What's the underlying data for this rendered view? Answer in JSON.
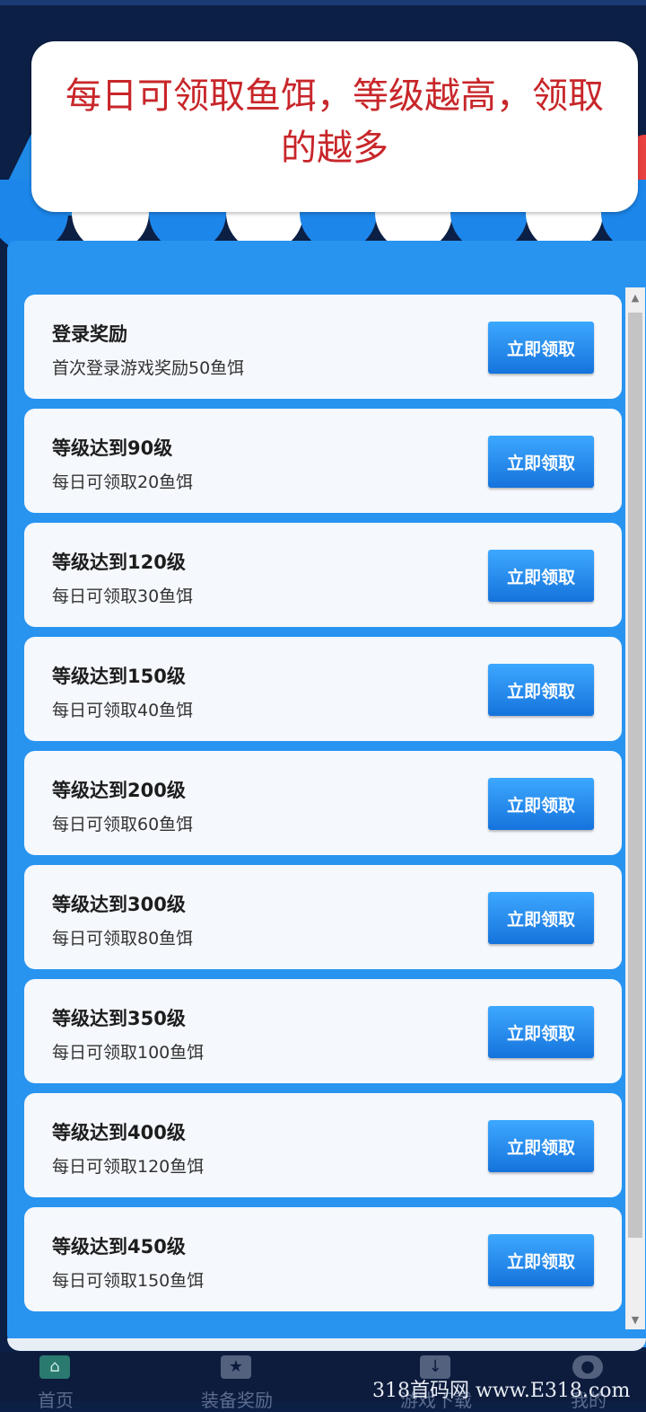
{
  "banner": {
    "text": "每日可领取鱼饵，等级越高，领取的越多"
  },
  "rewards": [
    {
      "title": "登录奖励",
      "desc": "首次登录游戏奖励50鱼饵",
      "button": "立即领取"
    },
    {
      "title": "等级达到90级",
      "desc": "每日可领取20鱼饵",
      "button": "立即领取"
    },
    {
      "title": "等级达到120级",
      "desc": "每日可领取30鱼饵",
      "button": "立即领取"
    },
    {
      "title": "等级达到150级",
      "desc": "每日可领取40鱼饵",
      "button": "立即领取"
    },
    {
      "title": "等级达到200级",
      "desc": "每日可领取60鱼饵",
      "button": "立即领取"
    },
    {
      "title": "等级达到300级",
      "desc": "每日可领取80鱼饵",
      "button": "立即领取"
    },
    {
      "title": "等级达到350级",
      "desc": "每日可领取100鱼饵",
      "button": "立即领取"
    },
    {
      "title": "等级达到400级",
      "desc": "每日可领取120鱼饵",
      "button": "立即领取"
    },
    {
      "title": "等级达到450级",
      "desc": "每日可领取150鱼饵",
      "button": "立即领取"
    }
  ],
  "nav": {
    "items": [
      {
        "label": "首页",
        "icon": "home-icon"
      },
      {
        "label": "装备奖励",
        "icon": "star-icon"
      },
      {
        "label": "游戏下载",
        "icon": "download-icon"
      },
      {
        "label": "我的",
        "icon": "user-icon"
      }
    ]
  },
  "watermark": "318首码网 www.E318.com",
  "colors": {
    "background": "#0c1f45",
    "panel": "#2894f0",
    "banner_text": "#c8262a",
    "button": "#1e88ea"
  }
}
